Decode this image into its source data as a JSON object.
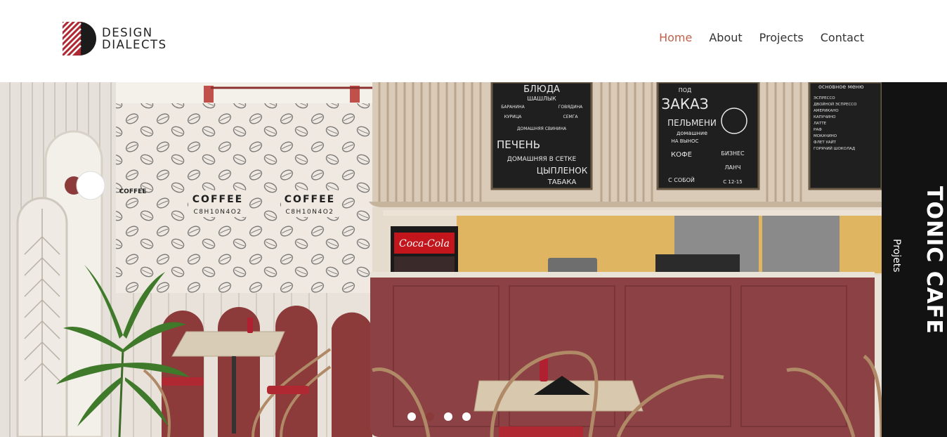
{
  "brand": {
    "name_line1": "DESIGN",
    "name_line2": "DIALECTS",
    "mark_color": "#b02832"
  },
  "nav": {
    "items": [
      {
        "label": "Home",
        "active": true
      },
      {
        "label": "About",
        "active": false
      },
      {
        "label": "Projects",
        "active": false
      },
      {
        "label": "Contact",
        "active": false
      }
    ]
  },
  "hero": {
    "wall_text": {
      "coffee": "COFFEE",
      "formula": "C8H10N4O2"
    },
    "menu_boards": {
      "board1": [
        "БЛЮДА",
        "ШАШЛЫК",
        "БАРАНИНА",
        "ГОВЯДИНА",
        "КУРИЦА",
        "СЕМГА",
        "ДОМАШНЯЯ СВИНИНА",
        "ПЕЧЕНЬ",
        "ДОМАШНЯЯ В СЕТКЕ",
        "ЦЫПЛЕНОК",
        "ТАБАКА"
      ],
      "board2": [
        "ПОД",
        "ЗАКАЗ",
        "ПЕЛЬМЕНИ",
        "домашние",
        "НА ВЫНОС",
        "КОФЕ",
        "С СОБОЙ",
        "БИЗНЕС",
        "ЛАНЧ",
        "С 12-15"
      ],
      "board3": [
        "основное меню",
        "ЭСПРЕССО",
        "ДВОЙНОЙ ЭСПРЕССО",
        "АМЕРИКАНО",
        "КАПУЧИНО",
        "ЛАТТЕ",
        "РАФ",
        "МОКАЧИНО",
        "ФЛЕТ УАЙТ",
        "ГОРЯЧИЙ ШОКОЛАД"
      ]
    },
    "fridge_brand": "Coca-Cola"
  },
  "side_panel": {
    "title": "TONIC CAFE",
    "subtitle": "Projets"
  },
  "slider": {
    "count": 4,
    "active_index": 1
  },
  "colors": {
    "accent": "#c0604a",
    "counter": "#8c4245",
    "panel": "#121212"
  }
}
